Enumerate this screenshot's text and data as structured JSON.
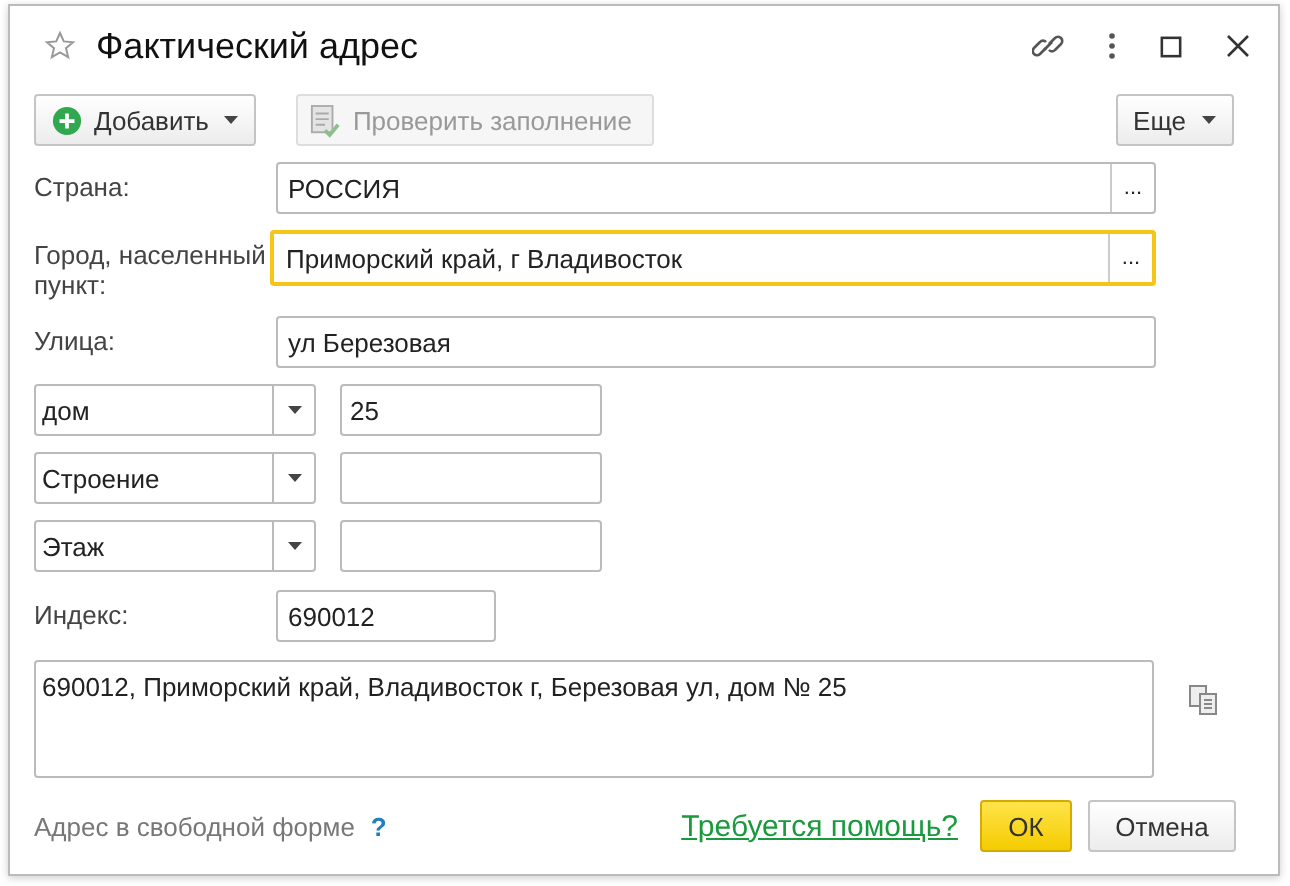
{
  "window": {
    "title": "Фактический адрес"
  },
  "toolbar": [
    {
      "label": "Добавить",
      "kind": "add",
      "dropdown": true,
      "disabled": false
    },
    {
      "label": "Проверить заполнение",
      "kind": "check",
      "dropdown": false,
      "disabled": true
    },
    {
      "label": "Еще",
      "kind": "more",
      "dropdown": true,
      "disabled": false
    }
  ],
  "fields": [
    {
      "label": "Страна:",
      "value": "РОССИЯ",
      "picker": "...",
      "focused": false
    },
    {
      "label": "Город, населенный пункт:",
      "value": "Приморский край, г Владивосток",
      "picker": "...",
      "focused": true
    },
    {
      "label": "Улица:",
      "value": "ул Березовая",
      "focused": false
    }
  ],
  "parts": [
    {
      "type": "дом",
      "value": "25"
    },
    {
      "type": "Строение"
    },
    {
      "type": "Этаж"
    }
  ],
  "index": {
    "label": "Индекс:",
    "value": "690012"
  },
  "presentation": "690012, Приморский край, Владивосток г, Березовая ул, дом № 25",
  "footer": {
    "free_form": "Адрес в свободной форме",
    "hint": "?",
    "help": "Требуется помощь?",
    "ok": "ОК",
    "cancel": "Отмена"
  }
}
